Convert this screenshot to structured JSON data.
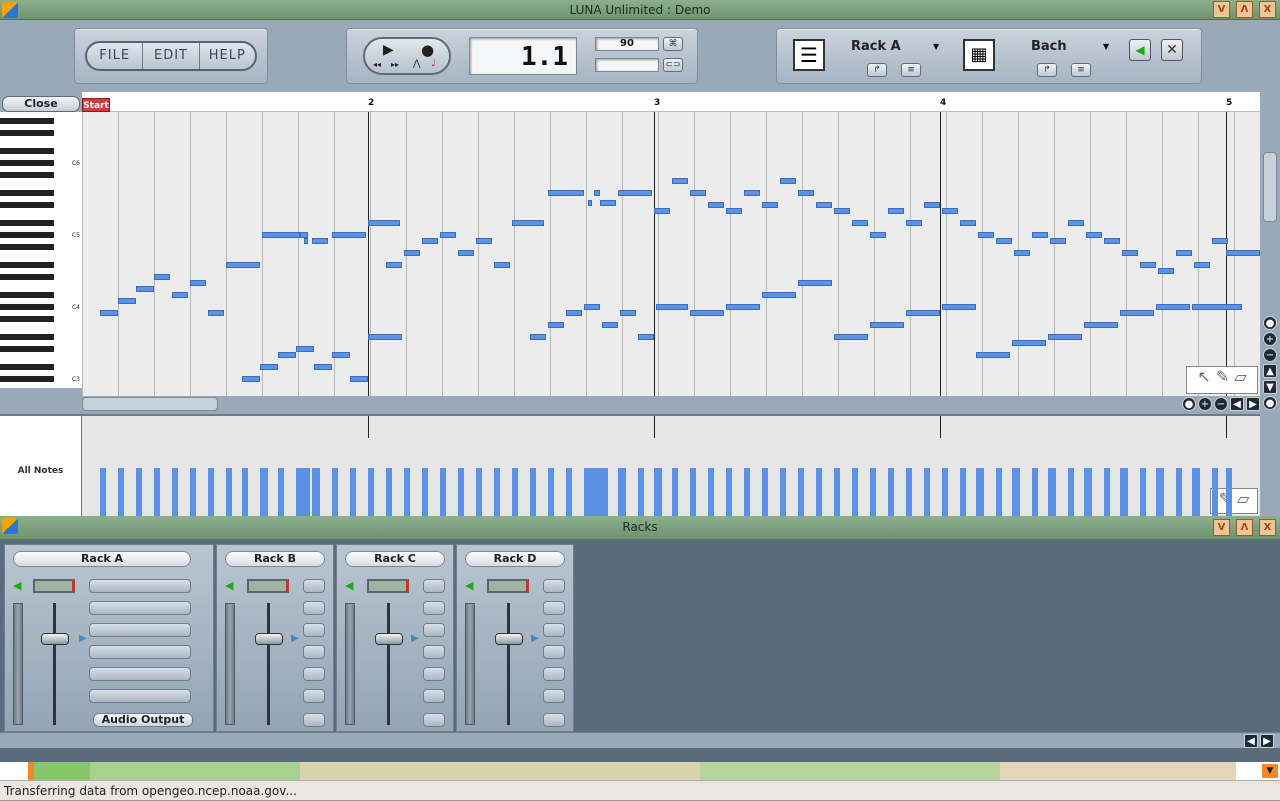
{
  "window": {
    "title": "LUNA Unlimited : Demo",
    "buttons": [
      "V",
      "Λ",
      "X"
    ]
  },
  "menu": {
    "items": [
      "FILE",
      "EDIT",
      "HELP"
    ]
  },
  "transport": {
    "position": "1.1",
    "tempo": "90",
    "tempo_secondary": ""
  },
  "instruments": {
    "rack_name": "Rack A",
    "instrument_name": "Bach"
  },
  "piano_roll": {
    "close_label": "Close",
    "start_label": "Start",
    "bar_numbers": [
      "2",
      "3",
      "4",
      "5"
    ],
    "octave_labels": [
      "C6",
      "C5",
      "C4",
      "C3"
    ]
  },
  "velocity": {
    "label": "All Notes"
  },
  "racks_window": {
    "title": "Racks",
    "racks": [
      {
        "name": "Rack A",
        "output": "Audio Output"
      },
      {
        "name": "Rack B"
      },
      {
        "name": "Rack C"
      },
      {
        "name": "Rack D"
      }
    ]
  },
  "status": {
    "text": "Transferring data from opengeo.ncep.noaa.gov..."
  },
  "colors": {
    "note": "#5b92e6",
    "title_bar": "#7fa47f",
    "panel": "#9aa9b8",
    "rack_bg": "#596b7d"
  },
  "notes": [
    [
      100,
      98,
      18
    ],
    [
      118,
      86,
      18
    ],
    [
      136,
      74,
      18
    ],
    [
      154,
      62,
      16
    ],
    [
      172,
      80,
      16
    ],
    [
      190,
      68,
      16
    ],
    [
      208,
      98,
      16
    ],
    [
      226,
      50,
      34
    ],
    [
      262,
      20,
      38
    ],
    [
      300,
      20,
      8
    ],
    [
      304,
      26,
      4
    ],
    [
      312,
      26,
      16
    ],
    [
      332,
      20,
      34
    ],
    [
      368,
      8,
      32
    ],
    [
      386,
      50,
      16
    ],
    [
      404,
      38,
      16
    ],
    [
      422,
      26,
      16
    ],
    [
      440,
      20,
      16
    ],
    [
      458,
      38,
      16
    ],
    [
      476,
      26,
      16
    ],
    [
      494,
      50,
      16
    ],
    [
      512,
      8,
      32
    ],
    [
      548,
      -22,
      36
    ],
    [
      588,
      -12,
      4
    ],
    [
      594,
      -22,
      6
    ],
    [
      600,
      -12,
      16
    ],
    [
      618,
      -22,
      34
    ],
    [
      654,
      -4,
      16
    ],
    [
      672,
      -34,
      16
    ],
    [
      690,
      -22,
      16
    ],
    [
      708,
      -10,
      16
    ],
    [
      726,
      -4,
      16
    ],
    [
      744,
      -22,
      16
    ],
    [
      762,
      -10,
      16
    ],
    [
      780,
      -34,
      16
    ],
    [
      798,
      -22,
      16
    ],
    [
      816,
      -10,
      16
    ],
    [
      834,
      -4,
      16
    ],
    [
      852,
      8,
      16
    ],
    [
      870,
      20,
      16
    ],
    [
      888,
      -4,
      16
    ],
    [
      906,
      8,
      16
    ],
    [
      924,
      -10,
      16
    ],
    [
      942,
      -4,
      16
    ],
    [
      960,
      8,
      16
    ],
    [
      978,
      20,
      16
    ],
    [
      996,
      26,
      16
    ],
    [
      1014,
      38,
      16
    ],
    [
      1032,
      20,
      16
    ],
    [
      1050,
      26,
      16
    ],
    [
      1068,
      8,
      16
    ],
    [
      1086,
      20,
      16
    ],
    [
      1104,
      26,
      16
    ],
    [
      1122,
      38,
      16
    ],
    [
      1140,
      50,
      16
    ],
    [
      1158,
      56,
      16
    ],
    [
      1176,
      38,
      16
    ],
    [
      1194,
      50,
      16
    ],
    [
      1212,
      26,
      16
    ],
    [
      1226,
      38,
      34
    ],
    [
      242,
      164,
      18
    ],
    [
      260,
      152,
      18
    ],
    [
      278,
      140,
      18
    ],
    [
      296,
      134,
      18
    ],
    [
      314,
      152,
      18
    ],
    [
      332,
      140,
      18
    ],
    [
      350,
      164,
      18
    ],
    [
      368,
      122,
      34
    ],
    [
      530,
      122,
      16
    ],
    [
      548,
      110,
      16
    ],
    [
      566,
      98,
      16
    ],
    [
      584,
      92,
      16
    ],
    [
      602,
      110,
      16
    ],
    [
      620,
      98,
      16
    ],
    [
      638,
      122,
      16
    ],
    [
      656,
      92,
      32
    ],
    [
      690,
      98,
      34
    ],
    [
      726,
      92,
      34
    ],
    [
      762,
      80,
      34
    ],
    [
      798,
      68,
      34
    ],
    [
      834,
      122,
      34
    ],
    [
      870,
      110,
      34
    ],
    [
      906,
      98,
      34
    ],
    [
      942,
      92,
      34
    ],
    [
      976,
      140,
      34
    ],
    [
      1012,
      128,
      34
    ],
    [
      1048,
      122,
      34
    ],
    [
      1084,
      110,
      34
    ],
    [
      1120,
      98,
      34
    ],
    [
      1156,
      92,
      34
    ],
    [
      1192,
      92,
      50
    ]
  ]
}
